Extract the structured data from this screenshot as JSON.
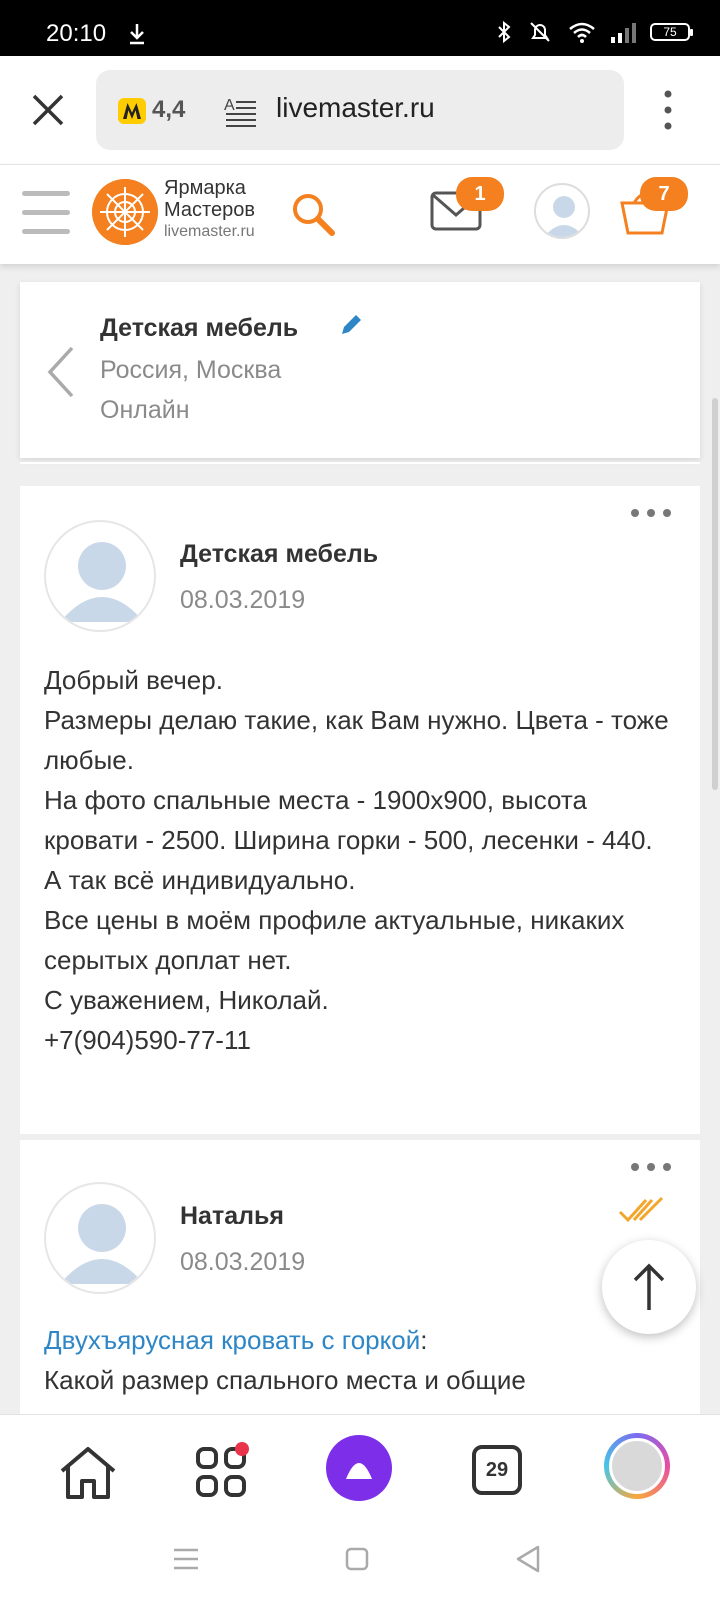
{
  "status_bar": {
    "time": "20:10",
    "battery": "75"
  },
  "browser": {
    "rating": "4,4",
    "url": "livemaster.ru"
  },
  "site": {
    "brand_line1": "Ярмарка",
    "brand_line2": "Мастеров",
    "brand_domain": "livemaster.ru",
    "mail_count": "1",
    "cart_count": "7",
    "accent_color": "#f4801f"
  },
  "dialog": {
    "title": "Детская мебель",
    "location": "Россия, Москва",
    "status": "Онлайн"
  },
  "messages": [
    {
      "author": "Детская мебель",
      "date": "08.03.2019",
      "lines": [
        "Добрый вечер.",
        "Размеры делаю такие, как Вам нужно. Цвета - тоже любые.",
        "На фото спальные места - 1900х900, высота кровати - 2500. Ширина горки - 500, лесенки - 440.",
        "А так всё индивидуально.",
        "Все цены в моём профиле актуальные, никаких серытых доплат нет.",
        "С уважением, Николай.",
        "+7(904)590-77-11"
      ]
    },
    {
      "author": "Наталья",
      "date": "08.03.2019",
      "link_text": "Двухъярусная кровать с горкой",
      "after_link": ":",
      "text": "Какой размер спального места и общие"
    }
  ],
  "bottom_nav": {
    "tabs_count": "29"
  }
}
